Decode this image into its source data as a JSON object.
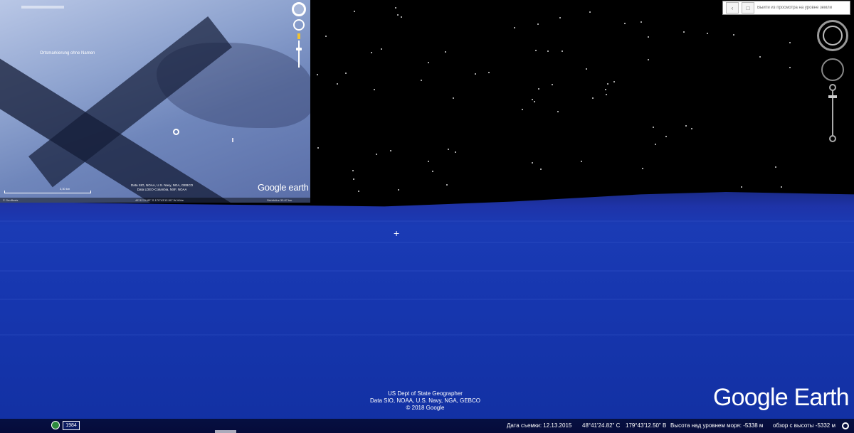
{
  "inset": {
    "pin_label": "Ortsmarkierung ohne Namen",
    "logo": "Google earth",
    "credit_line1": "Data SIO, NOAA, U.S. Navy, NGA, GEBCO",
    "credit_line2": "Data LDEO-Columbia, NSF, NOAA",
    "scale_label": "3,30 km",
    "status_left": "© GeoBasis",
    "status_coords": "48°41'24.82\" S 179°43'12.50\" W Höhe",
    "status_right": "Sichthöhe  33.87 km"
  },
  "search": {
    "placeholder": "Выйти из просмотра на уровне земли"
  },
  "credits": {
    "line1": "US Dept of State Geographer",
    "line2": "Data SIO, NOAA, U.S. Navy, NGA, GEBCO",
    "line3": "© 2018 Google"
  },
  "logo": "Google Earth",
  "status": {
    "year": "1984",
    "date": "Дата съемки: 12.13.2015",
    "lat": "48°41'24.82\" С",
    "lon": "179°43'12.50\" В",
    "elevation": "Высота над уровнем моря: -5338 м",
    "eye_alt": "обзор с высоты -5332 м"
  },
  "icons": {
    "crosshair": "crosshair-icon",
    "compass": "compass-icon",
    "look": "look-joystick-icon",
    "zoom": "zoom-slider-icon",
    "history": "history-clock-icon",
    "streaming": "streaming-ring-icon"
  },
  "colors": {
    "ocean": "#1a3bb5",
    "sky": "#000000",
    "statusbar": "#050b3a",
    "pegman": "#f1c232"
  }
}
